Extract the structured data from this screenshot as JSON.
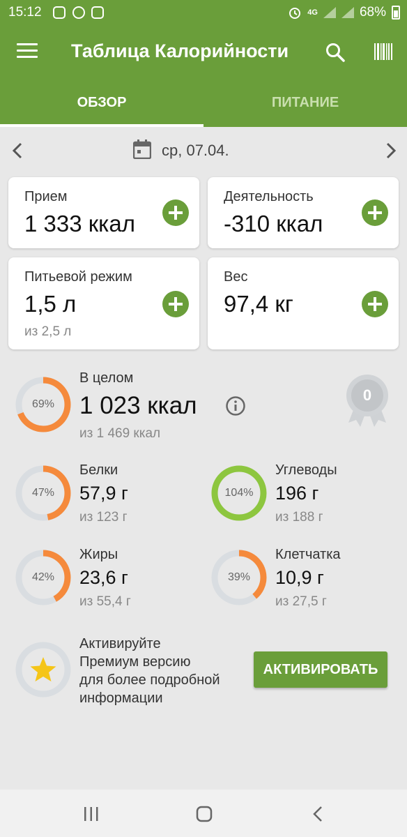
{
  "status_bar": {
    "time": "15:12",
    "network": "4G",
    "battery": "68%",
    "icons": [
      "instagram-icon",
      "shield-icon",
      "app-icon",
      "alarm-icon",
      "signal-icon",
      "signal-icon",
      "battery-icon"
    ]
  },
  "app_bar": {
    "title": "Таблица Калорийности",
    "icons": [
      "menu-icon",
      "search-icon",
      "barcode-icon"
    ]
  },
  "tabs": [
    {
      "label": "ОБЗОР",
      "active": true
    },
    {
      "label": "ПИТАНИЕ",
      "active": false
    }
  ],
  "date_nav": {
    "date": "ср, 07.04."
  },
  "cards": {
    "intake": {
      "label": "Прием",
      "value": "1 333 ккал"
    },
    "activity": {
      "label": "Деятельность",
      "value": "-310 ккал"
    },
    "water": {
      "label": "Питьевой режим",
      "value": "1,5 л",
      "sub": "из 2,5 л"
    },
    "weight": {
      "label": "Вес",
      "value": "97,4 кг"
    }
  },
  "overall": {
    "label": "В целом",
    "value": "1 023 ккал",
    "sub": "из 1 469 ккал",
    "percent": "69%",
    "progress": 0.69,
    "badge": "0"
  },
  "nutrients": {
    "protein": {
      "label": "Белки",
      "value": "57,9 г",
      "sub": "из 123 г",
      "percent": "47%",
      "progress": 0.47
    },
    "carbs": {
      "label": "Углеводы",
      "value": "196 г",
      "sub": "из 188 г",
      "percent": "104%",
      "progress": 1.0
    },
    "fat": {
      "label": "Жиры",
      "value": "23,6 г",
      "sub": "из 55,4 г",
      "percent": "42%",
      "progress": 0.42
    },
    "fiber": {
      "label": "Клетчатка",
      "value": "10,9 г",
      "sub": "из 27,5 г",
      "percent": "39%",
      "progress": 0.39
    }
  },
  "promo": {
    "text_lines": [
      "Активируйте",
      "Премиум версию",
      "для более подробной",
      "информации"
    ],
    "button_label": "АКТИВИРОВАТЬ"
  },
  "colors": {
    "brand": "#6a9e3a",
    "ring_orange": "#f58a3c",
    "ring_green": "#8dc63f",
    "ring_track": "#d9dde1",
    "star": "#f5c518"
  }
}
